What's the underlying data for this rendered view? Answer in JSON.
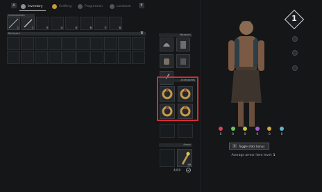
{
  "tabs": [
    {
      "key": "A",
      "label": "Inventory",
      "active": true
    },
    {
      "key": "",
      "label": "Crafting",
      "active": false
    },
    {
      "key": "",
      "label": "Progression",
      "active": false
    },
    {
      "key": "",
      "label": "Lorebook",
      "active": false
    }
  ],
  "hotbar": {
    "title": "Consumables",
    "slot_numbers": [
      "1",
      "2",
      "3",
      "4",
      "5",
      "6",
      "7",
      "8"
    ]
  },
  "backpack": {
    "title": "Backpack",
    "key": "B"
  },
  "weapons_panel": {
    "title": "Weapons"
  },
  "accessories_panel": {
    "title": "Accessories"
  },
  "armor_panel": {
    "title": "Armor",
    "count": "99"
  },
  "ammo_count": "4/0/0",
  "character": {
    "level": "1",
    "stats": [
      {
        "name": "health",
        "value": "0",
        "color": "#d24556"
      },
      {
        "name": "stamina",
        "value": "0",
        "color": "#6bc55a"
      },
      {
        "name": "vision",
        "value": "0",
        "color": "#c9c63b"
      },
      {
        "name": "mana",
        "value": "0",
        "color": "#a75bd1"
      },
      {
        "name": "fortune",
        "value": "0",
        "color": "#d6a43c"
      },
      {
        "name": "resistance",
        "value": "0",
        "color": "#5ab8d1"
      }
    ],
    "toggle_button": {
      "key": "T",
      "label": "Toggle stats bonus"
    },
    "armor_level_label": "Average armor item level:",
    "armor_level_value": "1"
  }
}
